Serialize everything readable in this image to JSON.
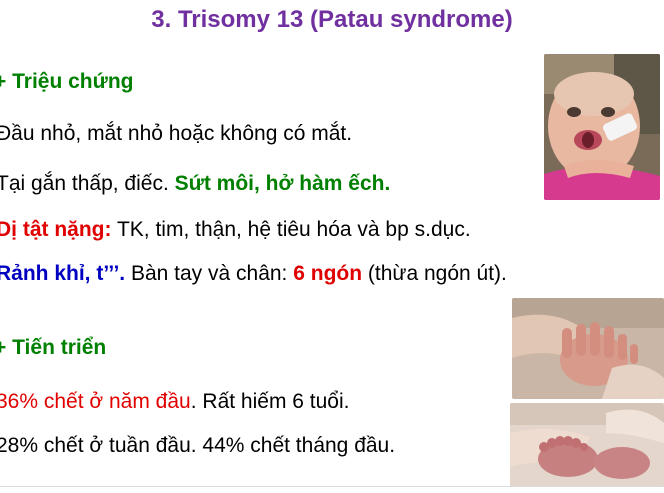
{
  "slide": {
    "title": "3. Trisomy 13 (Patau syndrome)",
    "section1": {
      "bullet": "+",
      "heading": "Triệu chứng",
      "line1": "Đầu nhỏ, mắt nhỏ hoặc không có mắt.",
      "line2_plain": "Tại gắn thấp, điếc. ",
      "line2_bold": "Sứt môi, hở hàm ếch.",
      "line3_label": "Dị tật nặng:",
      "line3_text": " TK, tim, thận, hệ tiêu hóa và bp s.dục.",
      "line4_label": "Rảnh khỉ, t’’’.",
      "line4_text1": " Bàn tay và chân: ",
      "line4_emph": "6 ngón",
      "line4_text2": " (thừa ngón út)."
    },
    "section2": {
      "bullet": "+",
      "heading": "Tiến triển",
      "line1_red": "36% chết ở năm đầu",
      "line1_text": ". Rất hiếm 6 tuổi.",
      "line2": "28% chết ở tuần đầu. 44% chết tháng đầu."
    }
  },
  "colors": {
    "title": "#7030a0",
    "heading": "#008000",
    "red": "#e00000",
    "blue": "#0000c0"
  }
}
